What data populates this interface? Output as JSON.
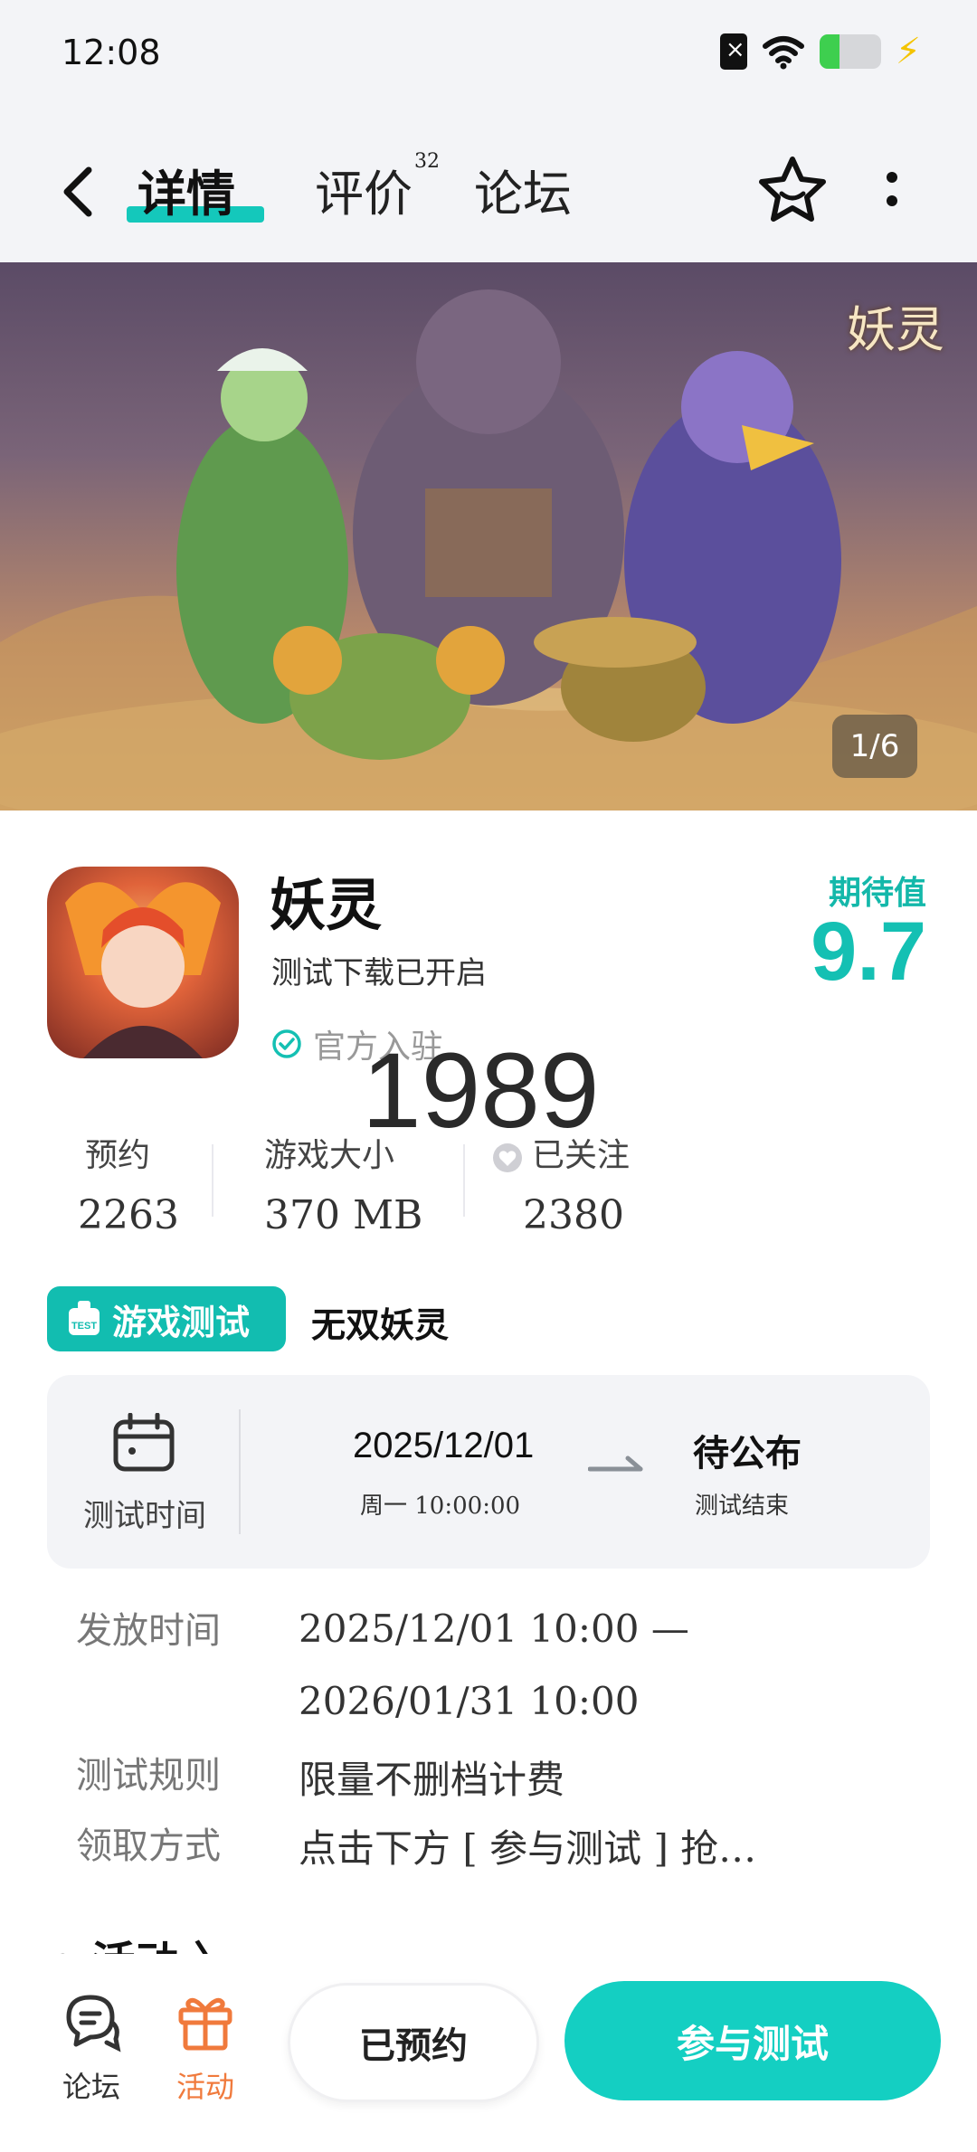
{
  "status_bar": {
    "time": "12:08",
    "battery_level": 0.32,
    "icons": [
      "sim-off-icon",
      "wifi-icon",
      "battery-icon",
      "charging-icon"
    ]
  },
  "nav": {
    "tabs": [
      {
        "label": "详情",
        "active": true
      },
      {
        "label": "评价",
        "badge": "32"
      },
      {
        "label": "论坛"
      }
    ],
    "icons": [
      "back-icon",
      "star-icon",
      "more-icon"
    ]
  },
  "banner": {
    "logo_text": "妖灵",
    "counter": "1/6"
  },
  "app": {
    "name": "妖灵",
    "subtitle": "测试下载已开启",
    "official": "官方入驻",
    "overlay_number": "1989",
    "expect_label": "期待值",
    "expect_score": "9.7"
  },
  "stats": [
    {
      "label": "预约",
      "value": "2263"
    },
    {
      "label": "游戏大小",
      "value": "370 MB"
    },
    {
      "label": "已关注",
      "value": "2380"
    }
  ],
  "test": {
    "tag": "游戏测试",
    "name": "无双妖灵",
    "time_label": "测试时间",
    "start_date": "2025/12/01",
    "start_time": "周一  10:00:00",
    "end_status": "待公布",
    "end_label": "测试结束"
  },
  "info_rows": [
    {
      "label": "发放时间",
      "value": "2025/12/01  10:00 —"
    },
    {
      "label": "",
      "value": "2026/01/31  10:00"
    },
    {
      "label": "测试规则",
      "value": "限量不删档计费"
    },
    {
      "label": "领取方式",
      "value": "点击下方 [ 参与测试 ] 抢…"
    }
  ],
  "activity_heading": "• 活动 〉",
  "bottom_bar": {
    "forum_label": "论坛",
    "activity_label": "活动",
    "reserved_label": "已预约",
    "join_label": "参与测试"
  },
  "colors": {
    "accent": "#14c8bb",
    "activity": "#f07a3c",
    "background": "#f3f4f7"
  }
}
